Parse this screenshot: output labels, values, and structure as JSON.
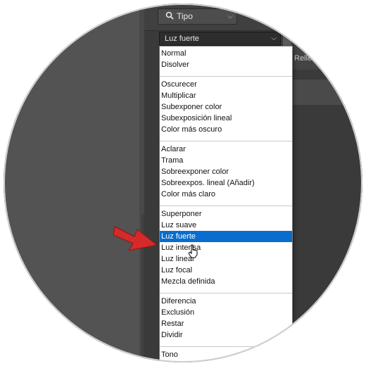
{
  "filter": {
    "icon": "search-icon",
    "label": "Tipo"
  },
  "blend_mode": {
    "selected": "Luz fuerte"
  },
  "side_text": "Relle",
  "menu": {
    "groups": [
      [
        "Normal",
        "Disolver"
      ],
      [
        "Oscurecer",
        "Multiplicar",
        "Subexponer color",
        "Subexposición lineal",
        "Color más oscuro"
      ],
      [
        "Aclarar",
        "Trama",
        "Sobreexponer color",
        "Sobreexpos. lineal (Añadir)",
        "Color más claro"
      ],
      [
        "Superponer",
        "Luz suave",
        "Luz fuerte",
        "Luz intensa",
        "Luz lineal",
        "Luz focal",
        "Mezcla definida"
      ],
      [
        "Diferencia",
        "Exclusión",
        "Restar",
        "Dividir"
      ],
      [
        "Tono"
      ]
    ],
    "selected": "Luz fuerte"
  },
  "colors": {
    "selection": "#0a6ccf",
    "arrow": "#d42a2a",
    "panel": "#3a3a3a",
    "canvas": "#535353"
  }
}
